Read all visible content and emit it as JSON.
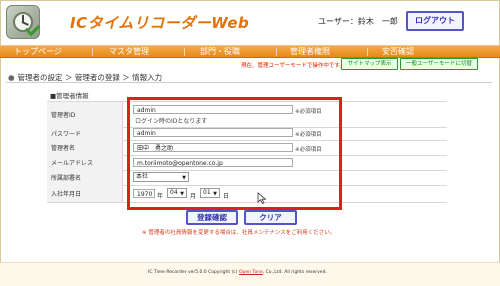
{
  "header": {
    "app_title": "ICタイムリコーダーWeb",
    "user_label": "ユーザー：鈴木　一郎",
    "logout_label": "ログアウト"
  },
  "nav": {
    "items": [
      "トップページ",
      "マスタ管理",
      "部門・役職",
      "管理者権限",
      "安否確認"
    ]
  },
  "mode_warning": "現在、管理ユーザーモードで操作中です。",
  "mode_buttons": {
    "sitemap": "サイトマップ表示",
    "user_mode": "一般ユーザーモードに切替"
  },
  "breadcrumb": {
    "bullet": "●",
    "text": "管理者の設定 ＞ 管理者の登録 ＞ 情報入力"
  },
  "section_title": "■管理者情報",
  "form": {
    "admin_id": {
      "label": "管理者ID",
      "value": "admin",
      "hint": "ログイン時のIDとなります",
      "required": "※必須項目"
    },
    "password": {
      "label": "パスワード",
      "value": "admin",
      "required": "※必須項目"
    },
    "admin_name": {
      "label": "管理者名",
      "value": "田中　勇之助",
      "required": "※必須項目"
    },
    "email": {
      "label": "メールアドレス",
      "value": "m.toriimoto@opentone.co.jp"
    },
    "department": {
      "label": "所属部署名",
      "value": "本社",
      "arrow": "▼"
    },
    "join_date": {
      "label": "入社年月日",
      "year": "1970",
      "year_unit": "年",
      "month": "04",
      "month_unit": "月",
      "day": "01",
      "day_unit": "日",
      "arrow": "▼"
    }
  },
  "actions": {
    "confirm": "登録確認",
    "clear": "クリア"
  },
  "bottom_note": "※ 管理者の社員情報を変更する場合は、社員メンテナンスをご利用ください。",
  "footer": {
    "prefix": "IC Time Recorder ver5.0.0 Copyright (c)",
    "company": "Open Tone",
    "suffix": ", Co.,Ltd. All rights reserved."
  }
}
